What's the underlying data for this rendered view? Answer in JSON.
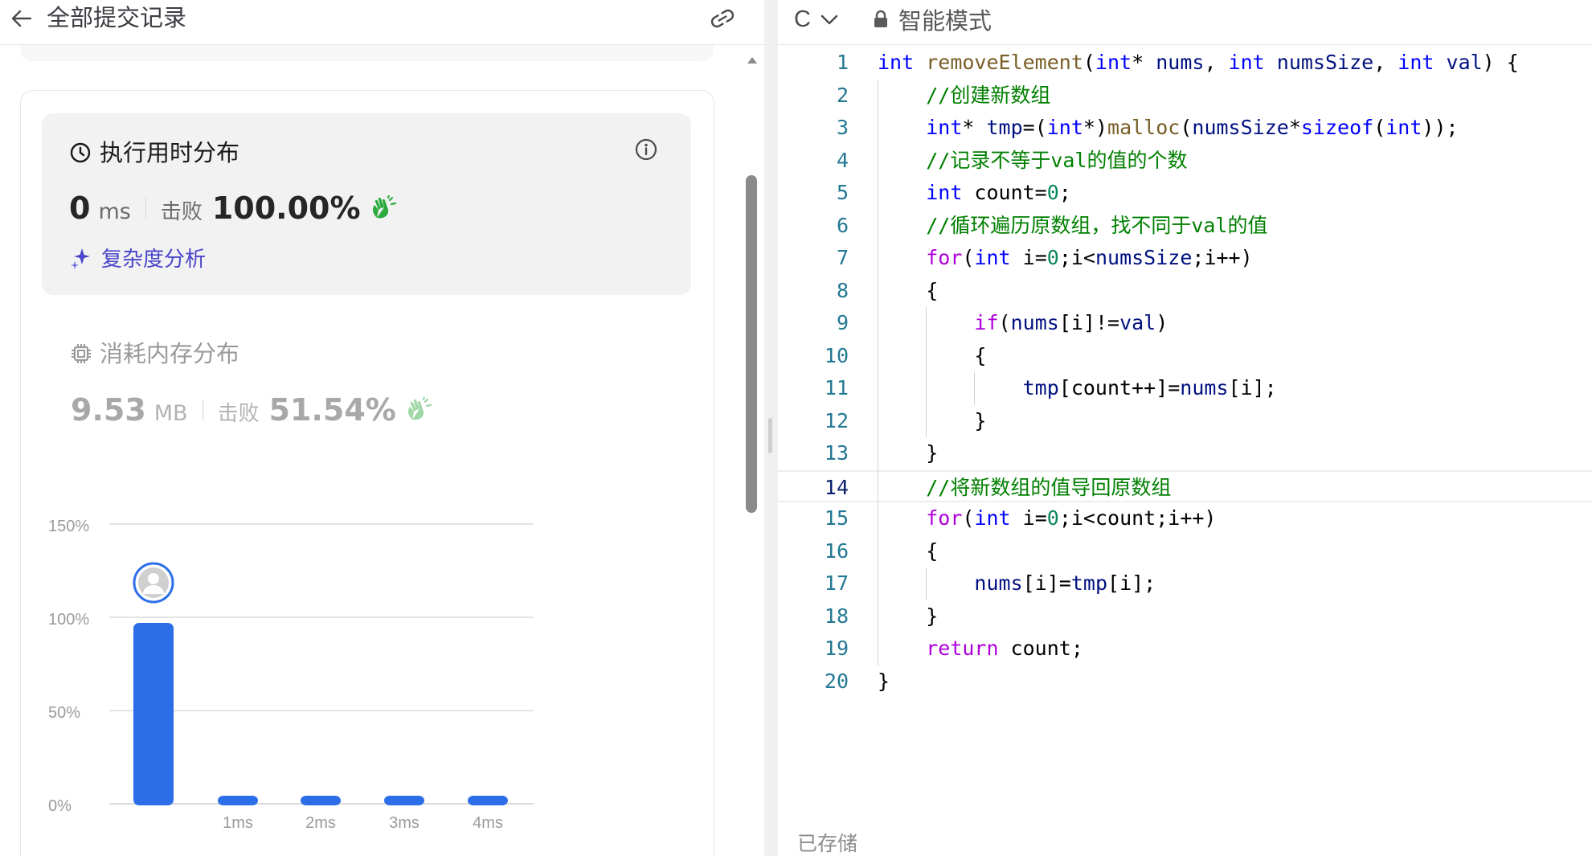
{
  "left_header": {
    "title": "全部提交记录"
  },
  "runtime": {
    "title": "执行用时分布",
    "value": "0",
    "unit": "ms",
    "beats_label": "击败",
    "beats_pct": "100.00%",
    "complexity_label": "复杂度分析"
  },
  "memory": {
    "title": "消耗内存分布",
    "value": "9.53",
    "unit": "MB",
    "beats_label": "击败",
    "beats_pct": "51.54%"
  },
  "colors": {
    "bar": "#2b6ee8",
    "accent_purple": "#4a46c9",
    "clap_green": "#2daa3f",
    "clap_green_light": "#9fd7a6"
  },
  "chart_data": {
    "type": "bar",
    "categories": [
      "",
      "1ms",
      "2ms",
      "3ms",
      "4ms"
    ],
    "values": [
      97,
      4,
      4,
      4,
      4
    ],
    "yticks": [
      "150%",
      "100%",
      "50%",
      "0%"
    ],
    "ylim": [
      0,
      150
    ],
    "grid": true,
    "marker": "user avatar above first bar"
  },
  "editor_header": {
    "language": "C",
    "mode_label": "智能模式"
  },
  "code": {
    "active_line": 14,
    "lines": [
      "int removeElement(int* nums, int numsSize, int val) {",
      "    //创建新数组",
      "    int* tmp=(int*)malloc(numsSize*sizeof(int));",
      "    //记录不等于val的值的个数",
      "    int count=0;",
      "    //循环遍历原数组，找不同于val的值",
      "    for(int i=0;i<numsSize;i++)",
      "    {",
      "        if(nums[i]!=val)",
      "        {",
      "            tmp[count++]=nums[i];",
      "        }",
      "    }",
      "    //将新数组的值导回原数组",
      "    for(int i=0;i<count;i++)",
      "    {",
      "        nums[i]=tmp[i];",
      "    }",
      "    return count;",
      "}"
    ]
  },
  "footer": {
    "saved_label": "已存储"
  }
}
